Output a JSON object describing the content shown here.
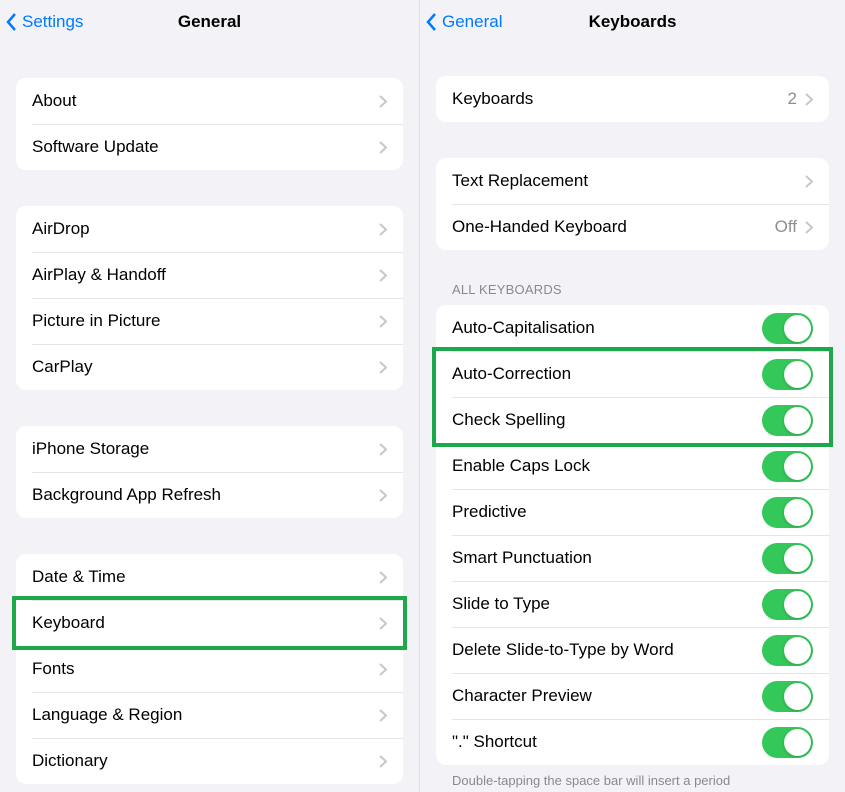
{
  "left": {
    "back_label": "Settings",
    "title": "General",
    "group1": [
      {
        "label": "About"
      },
      {
        "label": "Software Update"
      }
    ],
    "group2": [
      {
        "label": "AirDrop"
      },
      {
        "label": "AirPlay & Handoff"
      },
      {
        "label": "Picture in Picture"
      },
      {
        "label": "CarPlay"
      }
    ],
    "group3": [
      {
        "label": "iPhone Storage"
      },
      {
        "label": "Background App Refresh"
      }
    ],
    "group4": [
      {
        "label": "Date & Time"
      },
      {
        "label": "Keyboard"
      },
      {
        "label": "Fonts"
      },
      {
        "label": "Language & Region"
      },
      {
        "label": "Dictionary"
      }
    ]
  },
  "right": {
    "back_label": "General",
    "title": "Keyboards",
    "group1": [
      {
        "label": "Keyboards",
        "value": "2"
      }
    ],
    "group2": [
      {
        "label": "Text Replacement"
      },
      {
        "label": "One-Handed Keyboard",
        "value": "Off"
      }
    ],
    "section_header": "ALL KEYBOARDS",
    "toggles": [
      {
        "label": "Auto-Capitalisation",
        "on": true
      },
      {
        "label": "Auto-Correction",
        "on": true
      },
      {
        "label": "Check Spelling",
        "on": true
      },
      {
        "label": "Enable Caps Lock",
        "on": true
      },
      {
        "label": "Predictive",
        "on": true
      },
      {
        "label": "Smart Punctuation",
        "on": true
      },
      {
        "label": "Slide to Type",
        "on": true
      },
      {
        "label": "Delete Slide-to-Type by Word",
        "on": true
      },
      {
        "label": "Character Preview",
        "on": true
      },
      {
        "label": "\".\" Shortcut",
        "on": true
      }
    ],
    "footer": "Double-tapping the space bar will insert a period"
  },
  "highlights": {
    "keyboard_row": true,
    "autocorrect_checkspell": true
  }
}
